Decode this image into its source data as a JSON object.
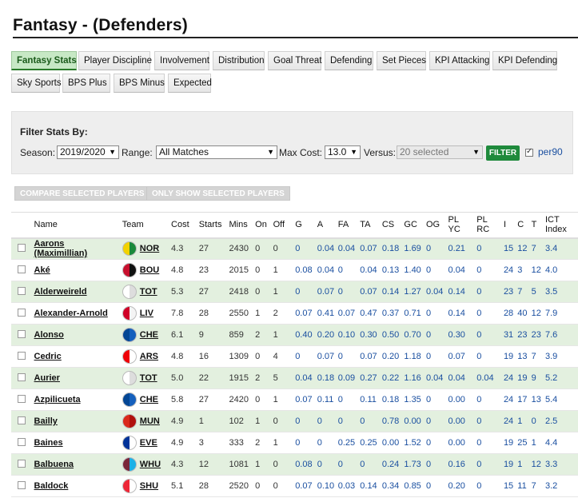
{
  "page": {
    "title": "Fantasy - (Defenders)"
  },
  "tabs": [
    {
      "label": "Fantasy Stats",
      "active": true
    },
    {
      "label": "Player Discipline",
      "active": false
    },
    {
      "label": "Involvement",
      "active": false
    },
    {
      "label": "Distribution",
      "active": false
    },
    {
      "label": "Goal Threat",
      "active": false
    },
    {
      "label": "Defending",
      "active": false
    },
    {
      "label": "Set Pieces",
      "active": false
    },
    {
      "label": "KPI Attacking",
      "active": false
    },
    {
      "label": "KPI Defending",
      "active": false
    },
    {
      "label": "Sky Sports",
      "active": false
    },
    {
      "label": "BPS Plus",
      "active": false
    },
    {
      "label": "BPS Minus",
      "active": false
    },
    {
      "label": "Expected",
      "active": false
    }
  ],
  "filter": {
    "heading": "Filter Stats By:",
    "season_label": "Season:",
    "season_value": "2019/2020",
    "range_label": "Range:",
    "range_value": "All Matches",
    "maxcost_label": "Max Cost:",
    "maxcost_value": "13.0",
    "versus_label": "Versus:",
    "versus_value": "20 selected",
    "filter_button": "FILTER",
    "per90_label": "per90",
    "per90_checked": true
  },
  "actions": {
    "compare": "COMPARE SELECTED PLAYERS",
    "only_show": "ONLY SHOW SELECTED PLAYERS"
  },
  "table": {
    "headers": [
      "Name",
      "Team",
      "Cost",
      "Starts",
      "Mins",
      "On",
      "Off",
      "G",
      "A",
      "FA",
      "TA",
      "CS",
      "GC",
      "OG",
      "PL\nYC",
      "PL\nRC",
      "I",
      "C",
      "T",
      "ICT\nIndex"
    ],
    "rows": [
      {
        "name": "Aarons\n(Maximillian)",
        "team": "NOR",
        "kit": [
          "#f2d200",
          "#1a8a3a"
        ],
        "vals": [
          "4.3",
          "27",
          "2430",
          "0",
          "0",
          "0",
          "0.04",
          "0.04",
          "0.07",
          "0.18",
          "1.69",
          "0",
          "0.21",
          "0",
          "15",
          "12",
          "7",
          "3.4"
        ]
      },
      {
        "name": "Aké",
        "team": "BOU",
        "kit": [
          "#c8102e",
          "#111111"
        ],
        "vals": [
          "4.8",
          "23",
          "2015",
          "0",
          "1",
          "0.08",
          "0.04",
          "0",
          "0.04",
          "0.13",
          "1.40",
          "0",
          "0.04",
          "0",
          "24",
          "3",
          "12",
          "4.0"
        ]
      },
      {
        "name": "Alderweireld",
        "team": "TOT",
        "kit": [
          "#ffffff",
          "#dddddd"
        ],
        "vals": [
          "5.3",
          "27",
          "2418",
          "0",
          "1",
          "0",
          "0.07",
          "0",
          "0.07",
          "0.14",
          "1.27",
          "0.04",
          "0.14",
          "0",
          "23",
          "7",
          "5",
          "3.5"
        ]
      },
      {
        "name": "Alexander-Arnold",
        "team": "LIV",
        "kit": [
          "#d00027",
          "#f4f4f4"
        ],
        "vals": [
          "7.8",
          "28",
          "2550",
          "1",
          "2",
          "0.07",
          "0.41",
          "0.07",
          "0.47",
          "0.37",
          "0.71",
          "0",
          "0.14",
          "0",
          "28",
          "40",
          "12",
          "7.9"
        ]
      },
      {
        "name": "Alonso",
        "team": "CHE",
        "kit": [
          "#034694",
          "#1560bd"
        ],
        "vals": [
          "6.1",
          "9",
          "859",
          "2",
          "1",
          "0.40",
          "0.20",
          "0.10",
          "0.30",
          "0.50",
          "0.70",
          "0",
          "0.30",
          "0",
          "31",
          "23",
          "23",
          "7.6"
        ]
      },
      {
        "name": "Cedric",
        "team": "ARS",
        "kit": [
          "#ef0107",
          "#ffffff"
        ],
        "vals": [
          "4.8",
          "16",
          "1309",
          "0",
          "4",
          "0",
          "0.07",
          "0",
          "0.07",
          "0.20",
          "1.18",
          "0",
          "0.07",
          "0",
          "19",
          "13",
          "7",
          "3.9"
        ]
      },
      {
        "name": "Aurier",
        "team": "TOT",
        "kit": [
          "#ffffff",
          "#dddddd"
        ],
        "vals": [
          "5.0",
          "22",
          "1915",
          "2",
          "5",
          "0.04",
          "0.18",
          "0.09",
          "0.27",
          "0.22",
          "1.16",
          "0.04",
          "0.04",
          "0.04",
          "24",
          "19",
          "9",
          "5.2"
        ]
      },
      {
        "name": "Azpilicueta",
        "team": "CHE",
        "kit": [
          "#034694",
          "#1560bd"
        ],
        "vals": [
          "5.8",
          "27",
          "2420",
          "0",
          "1",
          "0.07",
          "0.11",
          "0",
          "0.11",
          "0.18",
          "1.35",
          "0",
          "0.00",
          "0",
          "24",
          "17",
          "13",
          "5.4"
        ]
      },
      {
        "name": "Bailly",
        "team": "MUN",
        "kit": [
          "#da291c",
          "#b0100c"
        ],
        "vals": [
          "4.9",
          "1",
          "102",
          "1",
          "0",
          "0",
          "0",
          "0",
          "0",
          "0.78",
          "0.00",
          "0",
          "0.00",
          "0",
          "24",
          "1",
          "0",
          "2.5"
        ]
      },
      {
        "name": "Baines",
        "team": "EVE",
        "kit": [
          "#003399",
          "#ffffff"
        ],
        "vals": [
          "4.9",
          "3",
          "333",
          "2",
          "1",
          "0",
          "0",
          "0.25",
          "0.25",
          "0.00",
          "1.52",
          "0",
          "0.00",
          "0",
          "19",
          "25",
          "1",
          "4.4"
        ]
      },
      {
        "name": "Balbuena",
        "team": "WHU",
        "kit": [
          "#7a263a",
          "#1bb1e7"
        ],
        "vals": [
          "4.3",
          "12",
          "1081",
          "1",
          "0",
          "0.08",
          "0",
          "0",
          "0",
          "0.24",
          "1.73",
          "0",
          "0.16",
          "0",
          "19",
          "1",
          "12",
          "3.3"
        ]
      },
      {
        "name": "Baldock",
        "team": "SHU",
        "kit": [
          "#ee2737",
          "#ffffff"
        ],
        "vals": [
          "5.1",
          "28",
          "2520",
          "0",
          "0",
          "0.07",
          "0.10",
          "0.03",
          "0.14",
          "0.34",
          "0.85",
          "0",
          "0.20",
          "0",
          "15",
          "11",
          "7",
          "3.2"
        ]
      }
    ]
  }
}
